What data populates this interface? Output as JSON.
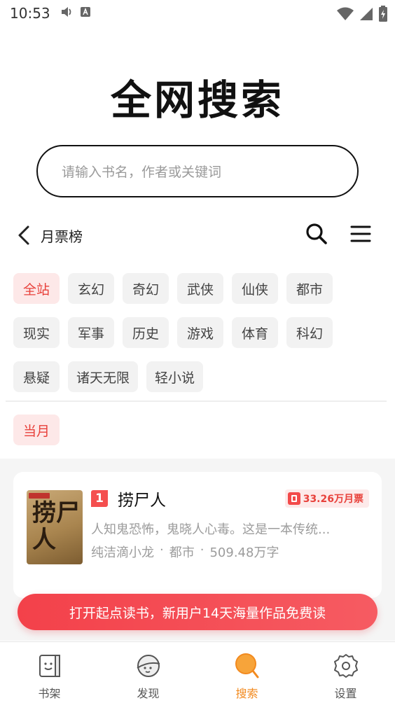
{
  "status_bar": {
    "time": "10:53"
  },
  "hero": {
    "title": "全网搜索"
  },
  "search": {
    "placeholder": "请输入书名，作者或关键词"
  },
  "ranking": {
    "title": "月票榜"
  },
  "categories": [
    "全站",
    "玄幻",
    "奇幻",
    "武侠",
    "仙侠",
    "都市",
    "现实",
    "军事",
    "历史",
    "游戏",
    "体育",
    "科幻",
    "悬疑",
    "诸天无限",
    "轻小说"
  ],
  "active_category": "全站",
  "period": {
    "label": "当月"
  },
  "book": {
    "rank": "1",
    "cover_text": "捞尸人",
    "title": "捞尸人",
    "tickets": "33.26万月票",
    "description": "人知鬼恐怖，鬼晓人心毒。这是一本传统...",
    "author": "纯洁滴小龙",
    "genre": "都市",
    "word_count": "509.48万字",
    "separator": "·"
  },
  "cta": {
    "label": "打开起点读书，新用户14天海量作品免费读"
  },
  "tabs": [
    {
      "label": "书架",
      "icon": "bookshelf-icon"
    },
    {
      "label": "发现",
      "icon": "discover-icon"
    },
    {
      "label": "搜索",
      "icon": "search-tab-icon"
    },
    {
      "label": "设置",
      "icon": "settings-icon"
    }
  ],
  "colors": {
    "accent": "#e8413b",
    "active_tab": "#f28a1f",
    "chip_bg": "#f2f2f2",
    "chip_active_bg": "#fde8e8"
  }
}
